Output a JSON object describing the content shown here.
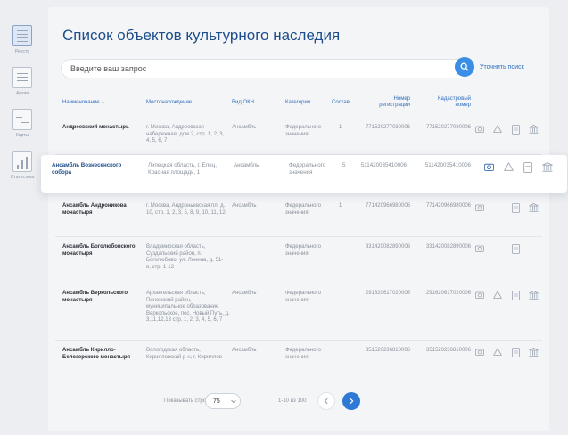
{
  "sidebar": {
    "items": [
      {
        "label": "Реестр",
        "icon": "registry-icon"
      },
      {
        "label": "Архив",
        "icon": "archive-icon"
      },
      {
        "label": "Карты",
        "icon": "maps-icon"
      },
      {
        "label": "Статистика",
        "icon": "statistics-icon"
      }
    ]
  },
  "page": {
    "title": "Список объектов культурного наследия",
    "search_placeholder": "Введите ваш запрос",
    "refine_link": "Уточнить поиск"
  },
  "table": {
    "headers": {
      "name": "Наименование ⌄",
      "location": "Местонахождение",
      "type": "Вид ОКН",
      "category": "Категория",
      "composition": "Состав",
      "reg_number_1": "Номер",
      "reg_number_2": "регистрации",
      "cadastral_1": "Кадастровый",
      "cadastral_2": "номер"
    },
    "rows": [
      {
        "name": "Андреевский монастырь",
        "location": "г. Москва, Андреевская набережная, дом 2, стр. 1, 2, 3, 4, 5, 6, 7",
        "type": "Ансамбль",
        "category": "Федерального значения",
        "composition": "1",
        "reg": "771520277030006",
        "cad": "771520277030006"
      },
      {
        "name": "Ансамбль Вознесенского собора",
        "location": "Липецкая область, г. Елец, Красная площадь, 1",
        "type": "Ансамбль",
        "category": "Федерального значения",
        "composition": "5",
        "reg": "511420035410006",
        "cad": "511420035410006"
      },
      {
        "name": "Ансамбль Андроникова монастыря",
        "location": "г. Москва, Андроньевская пл, д. 10, стр. 1, 2, 3, 5, 8, 9, 10, 11, 12",
        "type": "Ансамбль",
        "category": "Федерального значения",
        "composition": "1",
        "reg": "771420966980006",
        "cad": "771420966980006"
      },
      {
        "name": "Ансамбль Боголюбовского монастыря",
        "location": "Владимирская область, Суздальский район, п. Боголюбово, ул. Ленина, д. 51-в, стр. 1-12",
        "type": "",
        "category": "Федерального значения",
        "composition": "",
        "reg": "331420082890006",
        "cad": "331420082890006"
      },
      {
        "name": "Ансамбль Веркольского монастыря",
        "location": "Архангельская область, Пинежский район, муниципальное образование Веркольское, пос. Новый Путь, д. 3,11,12,13 стр. 1, 2, 3, 4, 5, 6, 7",
        "type": "Ансамбль",
        "category": "Федерального значения",
        "composition": "",
        "reg": "291620617020006",
        "cad": "291620617020006"
      },
      {
        "name": "Ансамбль Кирилло-Белозерского монастыря",
        "location": "Вологодская область, Кирилловский р-н, г. Кириллов",
        "type": "Ансамбль",
        "category": "Федерального значения",
        "composition": "",
        "reg": "351520236810006",
        "cad": "351520236810006"
      }
    ]
  },
  "pagination": {
    "rows_label": "Показывать строк",
    "rows_value": "75",
    "range": "1-10 из 100"
  },
  "colors": {
    "accent": "#2e79d6",
    "title": "#1d4d8b",
    "link": "#2f6fc0"
  }
}
